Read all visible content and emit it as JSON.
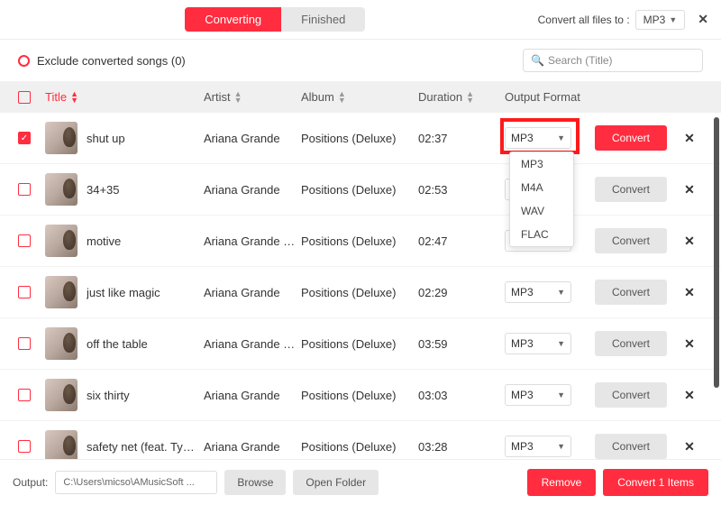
{
  "tabs": {
    "converting": "Converting",
    "finished": "Finished"
  },
  "convert_all": {
    "label": "Convert all files to :",
    "value": "MP3"
  },
  "exclude": {
    "label": "Exclude converted songs (0)"
  },
  "search": {
    "placeholder": "Search  (Title)"
  },
  "headers": {
    "title": "Title",
    "artist": "Artist",
    "album": "Album",
    "duration": "Duration",
    "format": "Output Format"
  },
  "format_options": [
    "MP3",
    "M4A",
    "WAV",
    "FLAC"
  ],
  "rows": [
    {
      "checked": true,
      "title": "shut up",
      "artist": "Ariana Grande",
      "album": "Positions (Deluxe)",
      "duration": "02:37",
      "format": "MP3",
      "primary": true
    },
    {
      "checked": false,
      "title": "34+35",
      "artist": "Ariana Grande",
      "album": "Positions (Deluxe)",
      "duration": "02:53",
      "format": "MP3",
      "primary": false
    },
    {
      "checked": false,
      "title": "motive",
      "artist": "Ariana Grande & ...",
      "album": "Positions (Deluxe)",
      "duration": "02:47",
      "format": "MP3",
      "primary": false
    },
    {
      "checked": false,
      "title": "just like magic",
      "artist": "Ariana Grande",
      "album": "Positions (Deluxe)",
      "duration": "02:29",
      "format": "MP3",
      "primary": false
    },
    {
      "checked": false,
      "title": "off the table",
      "artist": "Ariana Grande & ...",
      "album": "Positions (Deluxe)",
      "duration": "03:59",
      "format": "MP3",
      "primary": false
    },
    {
      "checked": false,
      "title": "six thirty",
      "artist": "Ariana Grande",
      "album": "Positions (Deluxe)",
      "duration": "03:03",
      "format": "MP3",
      "primary": false
    },
    {
      "checked": false,
      "title": "safety net (feat. Ty ...",
      "artist": "Ariana Grande",
      "album": "Positions (Deluxe)",
      "duration": "03:28",
      "format": "MP3",
      "primary": false
    }
  ],
  "convert_btn": "Convert",
  "footer": {
    "output_label": "Output:",
    "output_path": "C:\\Users\\micso\\AMusicSoft ...",
    "browse": "Browse",
    "open_folder": "Open Folder",
    "remove": "Remove",
    "convert_items": "Convert 1 Items"
  }
}
